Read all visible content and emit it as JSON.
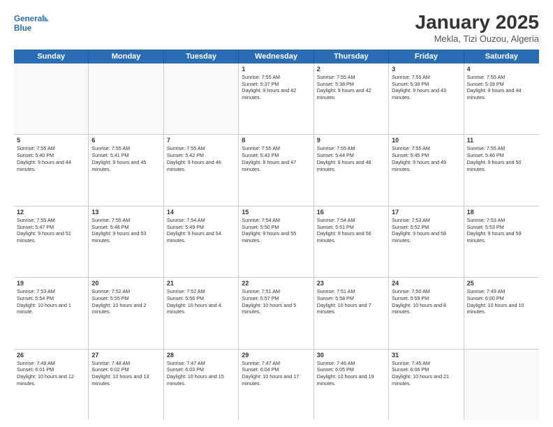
{
  "header": {
    "logo_line1": "General",
    "logo_line2": "Blue",
    "title": "January 2025",
    "subtitle": "Mekla, Tizi Ouzou, Algeria"
  },
  "days": [
    "Sunday",
    "Monday",
    "Tuesday",
    "Wednesday",
    "Thursday",
    "Friday",
    "Saturday"
  ],
  "weeks": [
    [
      {
        "day": "",
        "empty": true
      },
      {
        "day": "",
        "empty": true
      },
      {
        "day": "",
        "empty": true
      },
      {
        "day": "1",
        "rise": "7:55 AM",
        "set": "5:37 PM",
        "hours": "9 hours and 42 minutes."
      },
      {
        "day": "2",
        "rise": "7:55 AM",
        "set": "5:38 PM",
        "hours": "9 hours and 42 minutes."
      },
      {
        "day": "3",
        "rise": "7:55 AM",
        "set": "5:39 PM",
        "hours": "9 hours and 43 minutes."
      },
      {
        "day": "4",
        "rise": "7:55 AM",
        "set": "5:39 PM",
        "hours": "9 hours and 44 minutes."
      }
    ],
    [
      {
        "day": "5",
        "rise": "7:55 AM",
        "set": "5:40 PM",
        "hours": "9 hours and 44 minutes."
      },
      {
        "day": "6",
        "rise": "7:55 AM",
        "set": "5:41 PM",
        "hours": "9 hours and 45 minutes."
      },
      {
        "day": "7",
        "rise": "7:55 AM",
        "set": "5:42 PM",
        "hours": "9 hours and 46 minutes."
      },
      {
        "day": "8",
        "rise": "7:55 AM",
        "set": "5:43 PM",
        "hours": "9 hours and 47 minutes."
      },
      {
        "day": "9",
        "rise": "7:55 AM",
        "set": "5:44 PM",
        "hours": "9 hours and 48 minutes."
      },
      {
        "day": "10",
        "rise": "7:55 AM",
        "set": "5:45 PM",
        "hours": "9 hours and 49 minutes."
      },
      {
        "day": "11",
        "rise": "7:55 AM",
        "set": "5:46 PM",
        "hours": "9 hours and 50 minutes."
      }
    ],
    [
      {
        "day": "12",
        "rise": "7:55 AM",
        "set": "5:47 PM",
        "hours": "9 hours and 51 minutes."
      },
      {
        "day": "13",
        "rise": "7:55 AM",
        "set": "5:48 PM",
        "hours": "9 hours and 53 minutes."
      },
      {
        "day": "14",
        "rise": "7:54 AM",
        "set": "5:49 PM",
        "hours": "9 hours and 54 minutes."
      },
      {
        "day": "15",
        "rise": "7:54 AM",
        "set": "5:50 PM",
        "hours": "9 hours and 55 minutes."
      },
      {
        "day": "16",
        "rise": "7:54 AM",
        "set": "5:51 PM",
        "hours": "9 hours and 56 minutes."
      },
      {
        "day": "17",
        "rise": "7:53 AM",
        "set": "5:52 PM",
        "hours": "9 hours and 58 minutes."
      },
      {
        "day": "18",
        "rise": "7:53 AM",
        "set": "5:53 PM",
        "hours": "9 hours and 59 minutes."
      }
    ],
    [
      {
        "day": "19",
        "rise": "7:53 AM",
        "set": "5:54 PM",
        "hours": "10 hours and 1 minute."
      },
      {
        "day": "20",
        "rise": "7:52 AM",
        "set": "5:55 PM",
        "hours": "10 hours and 2 minutes."
      },
      {
        "day": "21",
        "rise": "7:52 AM",
        "set": "5:56 PM",
        "hours": "10 hours and 4 minutes."
      },
      {
        "day": "22",
        "rise": "7:51 AM",
        "set": "5:57 PM",
        "hours": "10 hours and 5 minutes."
      },
      {
        "day": "23",
        "rise": "7:51 AM",
        "set": "5:58 PM",
        "hours": "10 hours and 7 minutes."
      },
      {
        "day": "24",
        "rise": "7:50 AM",
        "set": "5:59 PM",
        "hours": "10 hours and 8 minutes."
      },
      {
        "day": "25",
        "rise": "7:49 AM",
        "set": "6:00 PM",
        "hours": "10 hours and 10 minutes."
      }
    ],
    [
      {
        "day": "26",
        "rise": "7:49 AM",
        "set": "6:01 PM",
        "hours": "10 hours and 12 minutes."
      },
      {
        "day": "27",
        "rise": "7:48 AM",
        "set": "6:02 PM",
        "hours": "10 hours and 13 minutes."
      },
      {
        "day": "28",
        "rise": "7:47 AM",
        "set": "6:03 PM",
        "hours": "10 hours and 15 minutes."
      },
      {
        "day": "29",
        "rise": "7:47 AM",
        "set": "6:04 PM",
        "hours": "10 hours and 17 minutes."
      },
      {
        "day": "30",
        "rise": "7:46 AM",
        "set": "6:05 PM",
        "hours": "10 hours and 19 minutes."
      },
      {
        "day": "31",
        "rise": "7:45 AM",
        "set": "6:06 PM",
        "hours": "10 hours and 21 minutes."
      },
      {
        "day": "",
        "empty": true
      }
    ]
  ]
}
